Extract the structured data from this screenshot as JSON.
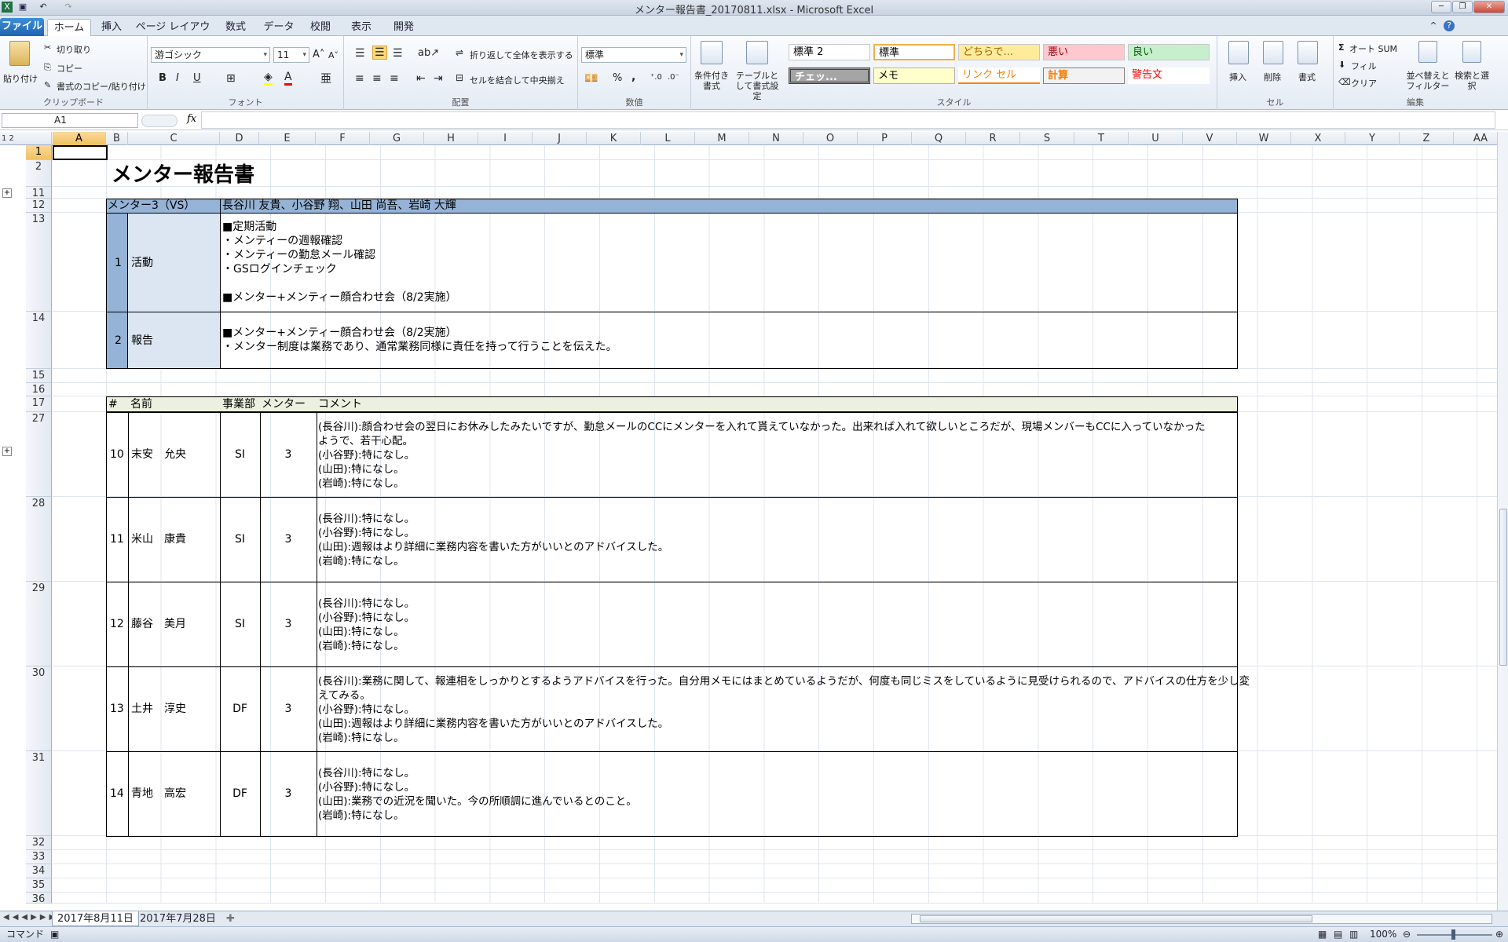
{
  "window": {
    "title": "メンター報告書_20170811.xlsx - Microsoft Excel"
  },
  "ribbon_tabs": [
    "ファイル",
    "ホーム",
    "挿入",
    "ページ レイアウト",
    "数式",
    "データ",
    "校閲",
    "表示",
    "開発"
  ],
  "clipboard": {
    "paste": "貼り付け",
    "cut": "切り取り",
    "copy": "コピー",
    "format_painter": "書式のコピー/貼り付け",
    "label": "クリップボード"
  },
  "font": {
    "name": "游ゴシック",
    "size": "11",
    "bold": "B",
    "italic": "I",
    "underline": "U",
    "label": "フォント"
  },
  "alignment": {
    "wrap": "折り返して全体を表示する",
    "merge": "セルを結合して中央揃え",
    "label": "配置"
  },
  "number": {
    "format": "標準",
    "percent": "%",
    "comma": ",",
    "label": "数値"
  },
  "styles": {
    "conditional": "条件付き書式",
    "table": "テーブルとして書式設定",
    "label": "スタイル",
    "cells": [
      "標準 2",
      "標準",
      "どちらで...",
      "悪い",
      "良い",
      "チェッ...",
      "メモ",
      "リンク セル",
      "計算",
      "警告文"
    ]
  },
  "cells_group": {
    "insert": "挿入",
    "delete": "削除",
    "format": "書式",
    "label": "セル"
  },
  "editing": {
    "autosum": "オート SUM",
    "fill": "フィル",
    "clear": "クリア",
    "sort": "並べ替えとフィルター",
    "find": "検索と選択",
    "label": "編集"
  },
  "formula_bar": {
    "name_box": "A1",
    "fx": "fx",
    "value": ""
  },
  "columns": [
    "A",
    "B",
    "C",
    "D",
    "E",
    "F",
    "G",
    "H",
    "I",
    "J",
    "K",
    "L",
    "M",
    "N",
    "O",
    "P",
    "Q",
    "R",
    "S",
    "T",
    "U",
    "V",
    "W",
    "X",
    "Y",
    "Z",
    "AA"
  ],
  "rows": [
    "1",
    "2",
    "11",
    "12",
    "13",
    "14",
    "15",
    "16",
    "17",
    "27",
    "28",
    "29",
    "30",
    "31",
    "32",
    "33",
    "34",
    "35",
    "36"
  ],
  "sheet": {
    "title": "メンター報告書",
    "mentor_label": "メンター3（VS）",
    "mentor_names": "長谷川 友貴、小谷野 翔、山田 尚吾、岩崎 大輝",
    "sections": [
      {
        "no": "1",
        "name": "活動",
        "text": "■定期活動\n・メンティーの週報確認\n・メンティーの勤怠メール確認\n・GSログインチェック\n\n■メンター+メンティー顔合わせ会（8/2実施）"
      },
      {
        "no": "2",
        "name": "報告",
        "text": "■メンター+メンティー顔合わせ会（8/2実施）\n・メンター制度は業務であり、通常業務同様に責任を持って行うことを伝えた。"
      }
    ],
    "table_headers": [
      "#",
      "名前",
      "事業部",
      "メンター",
      "コメント"
    ],
    "entries": [
      {
        "no": "10",
        "name": "末安　允央",
        "dept": "SI",
        "mentor": "3",
        "comment": "(長谷川):顔合わせ会の翌日にお休みしたみたいですが、勤怠メールのCCにメンターを入れて貰えていなかった。出来れば入れて欲しいところだが、現場メンバーもCCに入っていなかった\nようで、若干心配。\n(小谷野):特になし。\n(山田):特になし。\n(岩崎):特になし。"
      },
      {
        "no": "11",
        "name": "米山　康貴",
        "dept": "SI",
        "mentor": "3",
        "comment": "(長谷川):特になし。\n(小谷野):特になし。\n(山田):週報はより詳細に業務内容を書いた方がいいとのアドバイスした。\n(岩崎):特になし。"
      },
      {
        "no": "12",
        "name": "藤谷　美月",
        "dept": "SI",
        "mentor": "3",
        "comment": "(長谷川):特になし。\n(小谷野):特になし。\n(山田):特になし。\n(岩崎):特になし。"
      },
      {
        "no": "13",
        "name": "土井　淳史",
        "dept": "DF",
        "mentor": "3",
        "comment": "(長谷川):業務に関して、報連相をしっかりとするようアドバイスを行った。自分用メモにはまとめているようだが、何度も同じミスをしているように見受けられるので、アドバイスの仕方を少し変\nえてみる。\n(小谷野):特になし。\n(山田):週報はより詳細に業務内容を書いた方がいいとのアドバイスした。\n(岩崎):特になし。"
      },
      {
        "no": "14",
        "name": "青地　高宏",
        "dept": "DF",
        "mentor": "3",
        "comment": "(長谷川):特になし。\n(小谷野):特になし。\n(山田):業務での近況を聞いた。今の所順調に進んでいるとのこと。\n(岩崎):特になし。"
      }
    ]
  },
  "sheet_tabs": [
    "2017年8月11日",
    "2017年7月28日"
  ],
  "status": {
    "mode": "コマンド",
    "zoom": "100%"
  }
}
